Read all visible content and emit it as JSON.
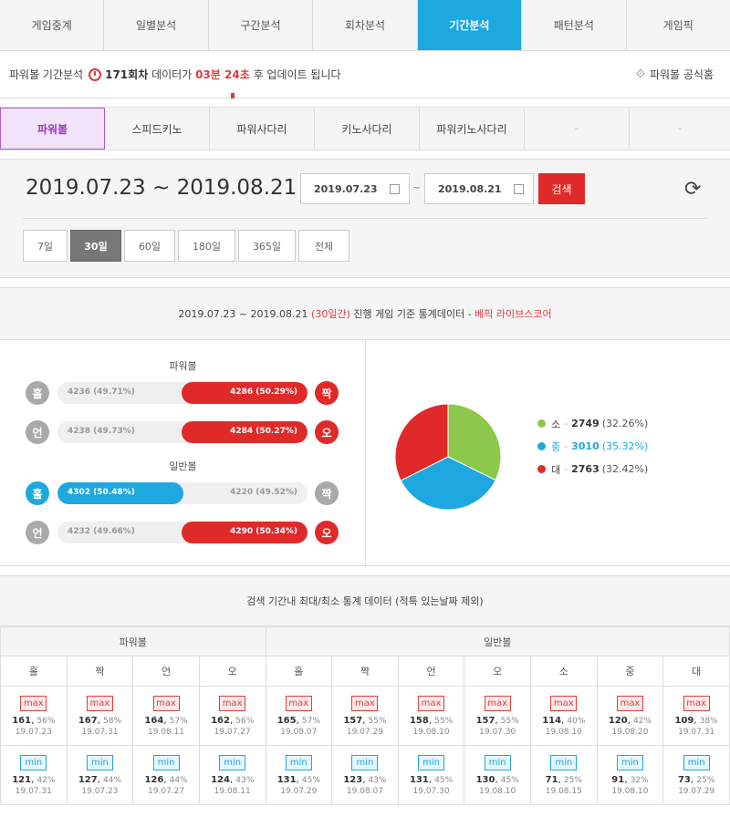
{
  "nav": {
    "tabs": [
      "게임중계",
      "일별분석",
      "구간분석",
      "회차분석",
      "기간분석",
      "패턴분석",
      "게임픽"
    ]
  },
  "info": {
    "prefix": "파워볼 기간분석",
    "round": "171회차",
    "mid": "데이터가",
    "time": "03분 24초",
    "suffix": "후 업데이트 됩니다",
    "home": "파워볼 공식홈"
  },
  "subnav": {
    "tabs": [
      "파워볼",
      "스피드키노",
      "파워사다리",
      "키노사다리",
      "파워키노사다리",
      "-",
      "-"
    ]
  },
  "dates": {
    "big": "2019.07.23  ~  2019.08.21",
    "from": "2019.07.23",
    "tilde": "~",
    "to": "2019.08.21",
    "search": "검색",
    "periods": [
      "7일",
      "30일",
      "60일",
      "180일",
      "365일",
      "전체"
    ]
  },
  "stats": {
    "range": "2019.07.23 ~ 2019.08.21",
    "days": "(30일간)",
    "desc": "진행 게임 기준 통계데이터 -",
    "source": "베픽 라이브스코어",
    "powerball_title": "파워볼",
    "normal_title": "일반볼",
    "rows": [
      {
        "left_icon": "홀",
        "left": "4236 (49.71%)",
        "right": "4286 (50.29%)",
        "right_icon": "짝",
        "value": 50.29
      },
      {
        "left_icon": "언",
        "left": "4238 (49.73%)",
        "right": "4284 (50.27%)",
        "right_icon": "오",
        "value": 50.27
      },
      {
        "left_icon": "홀",
        "left": "4302 (50.48%)",
        "right": "4220 (49.52%)",
        "right_icon": "짝",
        "value": 50.48
      },
      {
        "left_icon": "언",
        "left": "4232 (49.66%)",
        "right": "4290 (50.34%)",
        "right_icon": "오",
        "value": 50.34
      }
    ],
    "legend": [
      {
        "name": "소",
        "value": "2749",
        "pct": "(32.26%)",
        "color": "#8cc84b"
      },
      {
        "name": "중",
        "value": "3010",
        "pct": "(35.32%)",
        "color": "#1da8e0"
      },
      {
        "name": "대",
        "value": "2763",
        "pct": "(32.42%)",
        "color": "#e02a2a"
      }
    ]
  },
  "chart_data": {
    "type": "pie",
    "categories": [
      "소",
      "중",
      "대"
    ],
    "values": [
      2749,
      3010,
      2763
    ],
    "colors": [
      "#8cc84b",
      "#1da8e0",
      "#e02a2a"
    ]
  },
  "table": {
    "title": "검색 기간내 최대/최소 통계 데이터 (적특 있는날짜 제외)",
    "group_powerball": "파워볼",
    "group_normal": "일반볼",
    "columns": [
      "홀",
      "짝",
      "언",
      "오",
      "홀",
      "짝",
      "언",
      "오",
      "소",
      "중",
      "대"
    ],
    "max_label": "max",
    "min_label": "min",
    "max": [
      {
        "v": "161",
        "p": "56%",
        "d": "19.07.23"
      },
      {
        "v": "167",
        "p": "58%",
        "d": "19.07.31"
      },
      {
        "v": "164",
        "p": "57%",
        "d": "19.08.11"
      },
      {
        "v": "162",
        "p": "56%",
        "d": "19.07.27"
      },
      {
        "v": "165",
        "p": "57%",
        "d": "19.08.07"
      },
      {
        "v": "157",
        "p": "55%",
        "d": "19.07.29"
      },
      {
        "v": "158",
        "p": "55%",
        "d": "19.08.10"
      },
      {
        "v": "157",
        "p": "55%",
        "d": "19.07.30"
      },
      {
        "v": "114",
        "p": "40%",
        "d": "19.08.10"
      },
      {
        "v": "120",
        "p": "42%",
        "d": "19.08.20"
      },
      {
        "v": "109",
        "p": "38%",
        "d": "19.07.31"
      }
    ],
    "min": [
      {
        "v": "121",
        "p": "42%",
        "d": "19.07.31"
      },
      {
        "v": "127",
        "p": "44%",
        "d": "19.07.23"
      },
      {
        "v": "126",
        "p": "44%",
        "d": "19.07.27"
      },
      {
        "v": "124",
        "p": "43%",
        "d": "19.08.11"
      },
      {
        "v": "131",
        "p": "45%",
        "d": "19.07.29"
      },
      {
        "v": "123",
        "p": "43%",
        "d": "19.08.07"
      },
      {
        "v": "131",
        "p": "45%",
        "d": "19.07.30"
      },
      {
        "v": "130",
        "p": "45%",
        "d": "19.08.10"
      },
      {
        "v": "71",
        "p": "25%",
        "d": "19.08.15"
      },
      {
        "v": "91",
        "p": "32%",
        "d": "19.08.10"
      },
      {
        "v": "73",
        "p": "25%",
        "d": "19.07.29"
      }
    ]
  }
}
